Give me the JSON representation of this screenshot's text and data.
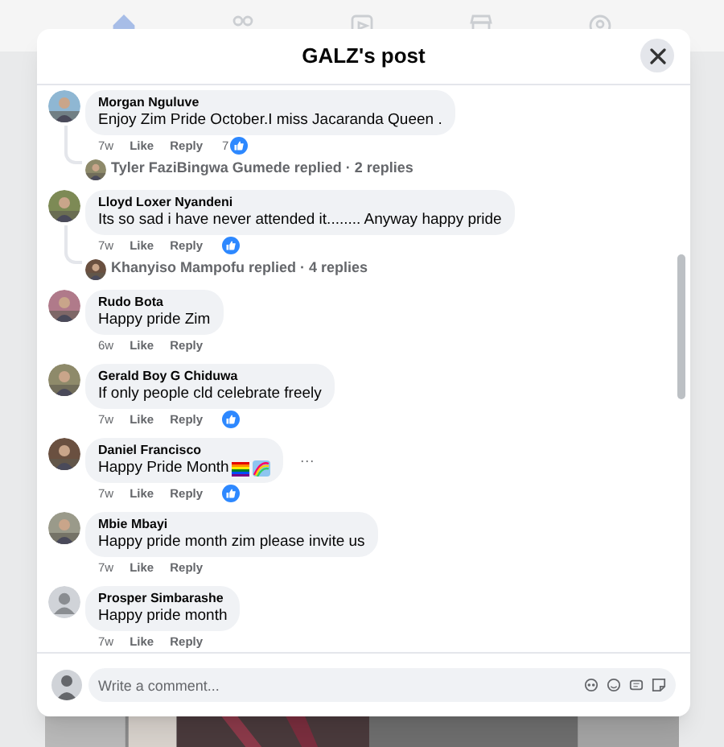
{
  "nav_tabs": [
    {
      "selected": true
    },
    {
      "selected": false
    },
    {
      "selected": false
    },
    {
      "selected": false
    },
    {
      "selected": false
    }
  ],
  "dialog": {
    "title": "GALZ's post"
  },
  "comments": [
    {
      "name": "Morgan Nguluve",
      "text": "Enjoy Zim Pride October.I miss Jacaranda Queen .",
      "time": "7w",
      "like": "Like",
      "reply": "Reply",
      "reaction": true,
      "reaction_count": "7",
      "replies": "Tyler FaziBingwa Gumede replied · 2 replies"
    },
    {
      "name": "Lloyd Loxer Nyandeni",
      "text": "Its so sad i have never attended it........ Anyway happy pride",
      "time": "7w",
      "like": "Like",
      "reply": "Reply",
      "reaction": true,
      "replies": "Khanyiso Mampofu replied · 4 replies"
    },
    {
      "name": "Rudo Bota",
      "text": "Happy pride Zim",
      "time": "6w",
      "like": "Like",
      "reply": "Reply",
      "reaction": false
    },
    {
      "name": "Gerald Boy G Chiduwa",
      "text": "If only people cld celebrate freely",
      "time": "7w",
      "like": "Like",
      "reply": "Reply",
      "reaction": true
    },
    {
      "name": "Daniel Francisco",
      "text": "Happy Pride Month",
      "pride_emojis": true,
      "time": "7w",
      "like": "Like",
      "reply": "Reply",
      "reaction": true,
      "more": "···"
    },
    {
      "name": "Mbie Mbayi",
      "text": "Happy pride month zim please invite us",
      "time": "7w",
      "like": "Like",
      "reply": "Reply",
      "reaction": false
    },
    {
      "kind": "default",
      "name": "Prosper Simbarashe",
      "text": "Happy pride month",
      "time": "7w",
      "like": "Like",
      "reply": "Reply",
      "reaction": false
    }
  ],
  "composer": {
    "placeholder": "Write a comment..."
  }
}
